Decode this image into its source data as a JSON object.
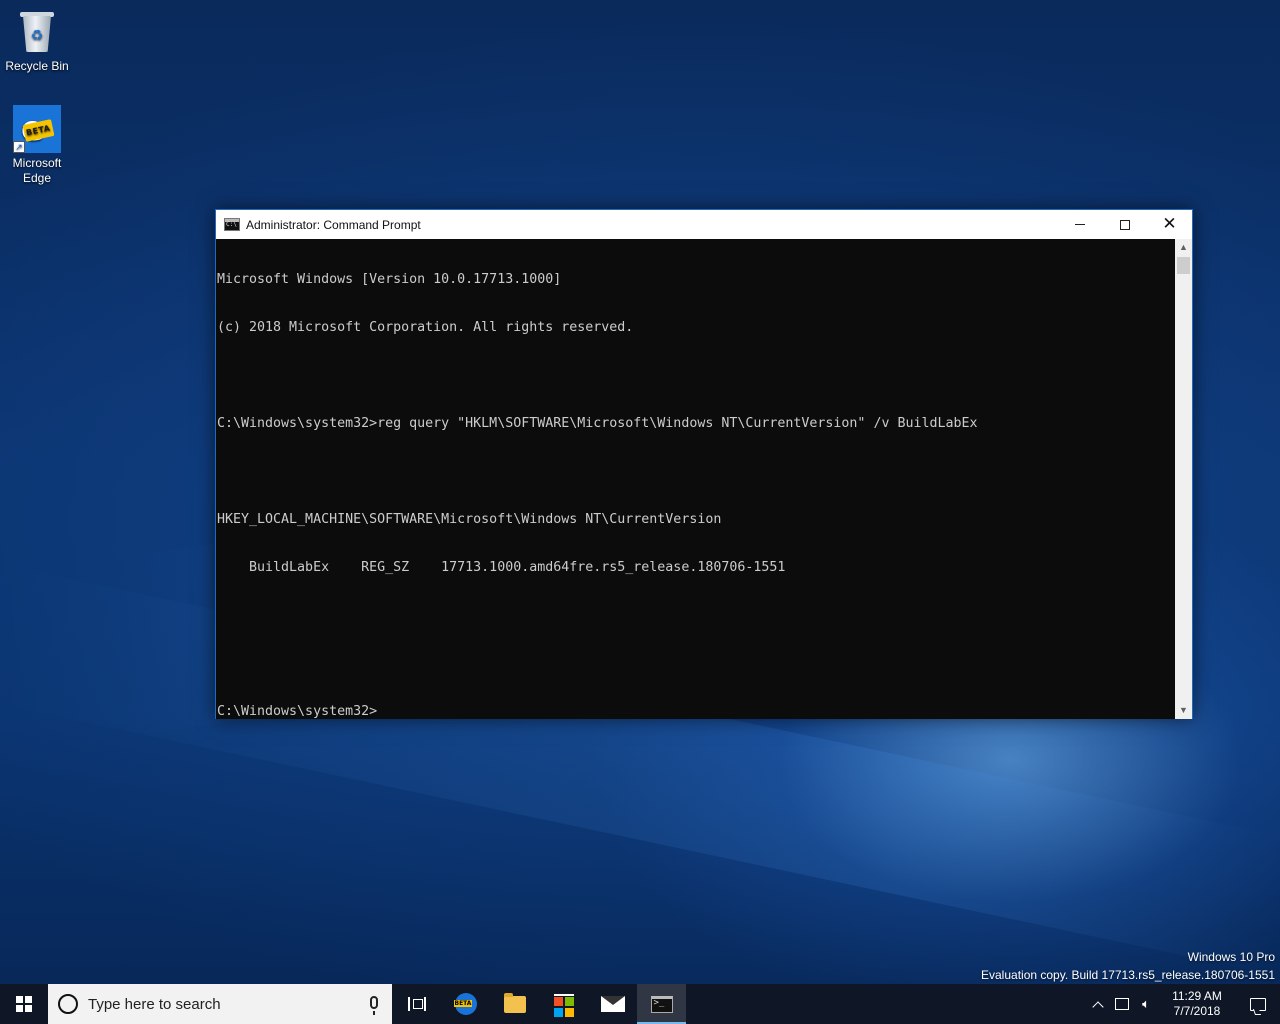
{
  "desktop": {
    "icons": [
      {
        "label": "Recycle Bin",
        "icon": "recycle-bin-icon"
      },
      {
        "label": "Microsoft Edge",
        "icon": "edge-icon",
        "badge": "BETA"
      }
    ],
    "watermark": {
      "edition": "Windows 10 Pro",
      "build": "Evaluation copy. Build 17713.rs5_release.180706-1551"
    }
  },
  "window": {
    "title": "Administrator: Command Prompt",
    "icon": "cmd-icon",
    "console_lines": [
      "Microsoft Windows [Version 10.0.17713.1000]",
      "(c) 2018 Microsoft Corporation. All rights reserved.",
      "",
      "C:\\Windows\\system32>reg query \"HKLM\\SOFTWARE\\Microsoft\\Windows NT\\CurrentVersion\" /v BuildLabEx",
      "",
      "HKEY_LOCAL_MACHINE\\SOFTWARE\\Microsoft\\Windows NT\\CurrentVersion",
      "    BuildLabEx    REG_SZ    17713.1000.amd64fre.rs5_release.180706-1551",
      "",
      "",
      "C:\\Windows\\system32>"
    ],
    "colors": {
      "console_bg": "#0c0c0c",
      "console_fg": "#cccccc",
      "border": "#1f6bc2"
    }
  },
  "taskbar": {
    "search_placeholder": "Type here to search",
    "pinned": [
      {
        "name": "task-view",
        "icon": "task-view-icon"
      },
      {
        "name": "edge",
        "icon": "edge-beta-icon"
      },
      {
        "name": "file-explorer",
        "icon": "folder-icon"
      },
      {
        "name": "store",
        "icon": "store-icon"
      },
      {
        "name": "mail",
        "icon": "mail-icon"
      },
      {
        "name": "command-prompt",
        "icon": "cmd-icon",
        "active": true
      }
    ],
    "clock": {
      "time": "11:29 AM",
      "date": "7/7/2018"
    }
  }
}
